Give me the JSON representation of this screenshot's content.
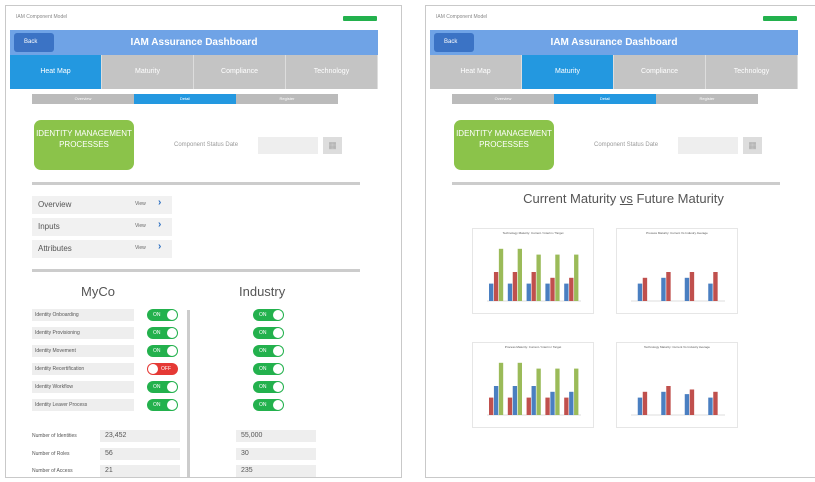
{
  "left": {
    "status_title": "IAM Component Model",
    "back": "Back",
    "title": "IAM Assurance Dashboard",
    "tabs": [
      "Heat Map",
      "Maturity",
      "Compliance",
      "Technology"
    ],
    "subtabs": [
      "Overview",
      "Detail",
      "Register"
    ],
    "process": "IDENTITY MANAGEMENT PROCESSES",
    "status_date_label": "Component Status Date",
    "links": [
      {
        "label": "Overview",
        "action": "View"
      },
      {
        "label": "Inputs",
        "action": "View"
      },
      {
        "label": "Attributes",
        "action": "View"
      }
    ],
    "col_myco": "MyCo",
    "col_industry": "Industry",
    "items": [
      {
        "label": "Identity Onboarding",
        "myco": "ON",
        "industry": "ON"
      },
      {
        "label": "Identity Provisioning",
        "myco": "ON",
        "industry": "ON"
      },
      {
        "label": "Identity Movement",
        "myco": "ON",
        "industry": "ON"
      },
      {
        "label": "Identity Recertification",
        "myco": "OFF",
        "industry": "ON"
      },
      {
        "label": "Identity Workflow",
        "myco": "ON",
        "industry": "ON"
      },
      {
        "label": "Identity Leaver Process",
        "myco": "ON",
        "industry": "ON"
      }
    ],
    "numbers": [
      {
        "label": "Number of Identities",
        "myco": "23,452",
        "industry": "55,000"
      },
      {
        "label": "Number of Roles",
        "myco": "56",
        "industry": "30"
      },
      {
        "label": "Number of Access",
        "myco": "21",
        "industry": "235"
      }
    ]
  },
  "right": {
    "status_title": "IAM Component Model",
    "back": "Back",
    "title": "IAM Assurance Dashboard",
    "tabs": [
      "Heat Map",
      "Maturity",
      "Compliance",
      "Technology"
    ],
    "subtabs": [
      "Overview",
      "Detail",
      "Register"
    ],
    "process": "IDENTITY MANAGEMENT PROCESSES",
    "status_date_label": "Component Status Date",
    "heading_a": "Current Maturity ",
    "heading_vs": "vs",
    "heading_b": " Future Maturity"
  },
  "chart_data": [
    {
      "type": "bar",
      "title": "Technology Maturity: Current / Interim / Target",
      "categories": [
        "",
        "",
        "",
        "",
        ""
      ],
      "series": [
        {
          "name": "",
          "values": [
            1.5,
            1.5,
            1.5,
            1.5,
            1.5
          ]
        },
        {
          "name": "",
          "values": [
            2.5,
            2.5,
            2.5,
            2.0,
            2.0
          ]
        },
        {
          "name": "",
          "values": [
            4.5,
            4.5,
            4.0,
            4.0,
            4.0
          ]
        }
      ],
      "colors": [
        "#4a7fc1",
        "#c0504d",
        "#9bbb59"
      ]
    },
    {
      "type": "bar",
      "title": "Process Maturity: Current Vs Industry Average",
      "categories": [
        "",
        "",
        "",
        ""
      ],
      "series": [
        {
          "name": "",
          "values": [
            1.5,
            2.0,
            2.0,
            1.5
          ]
        },
        {
          "name": "",
          "values": [
            2.0,
            2.5,
            2.5,
            2.5
          ]
        }
      ],
      "colors": [
        "#4a7fc1",
        "#c0504d"
      ]
    },
    {
      "type": "bar",
      "title": "Process Maturity: Current / Interim / Target",
      "categories": [
        "",
        "",
        "",
        "",
        ""
      ],
      "series": [
        {
          "name": "",
          "values": [
            1.5,
            1.5,
            1.5,
            1.5,
            1.5
          ]
        },
        {
          "name": "",
          "values": [
            2.5,
            2.5,
            2.5,
            2.0,
            2.0
          ]
        },
        {
          "name": "",
          "values": [
            4.5,
            4.5,
            4.0,
            4.0,
            4.0
          ]
        }
      ],
      "colors": [
        "#c0504d",
        "#4a7fc1",
        "#9bbb59"
      ]
    },
    {
      "type": "bar",
      "title": "Technology Maturity: Current Vs Industry Average",
      "categories": [
        "",
        "",
        "",
        ""
      ],
      "series": [
        {
          "name": "",
          "values": [
            1.5,
            2.0,
            1.8,
            1.5
          ]
        },
        {
          "name": "",
          "values": [
            2.0,
            2.5,
            2.2,
            2.0
          ]
        }
      ],
      "colors": [
        "#4a7fc1",
        "#c0504d"
      ]
    }
  ],
  "colors": {
    "header": "#6fa3e6",
    "tab_active": "#2398e0",
    "on": "#23b14d",
    "off": "#e53935",
    "process": "#8bc34a"
  }
}
